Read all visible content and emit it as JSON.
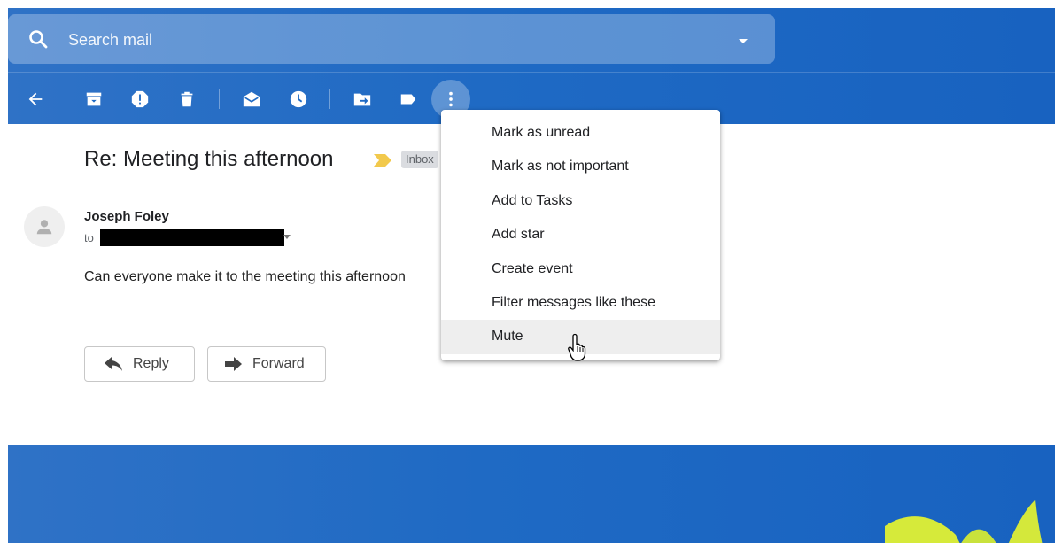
{
  "search": {
    "placeholder": "Search mail"
  },
  "toolbar": {
    "icons": [
      "back-arrow-icon",
      "archive-icon",
      "report-spam-icon",
      "delete-icon",
      "mark-read-icon",
      "snooze-icon",
      "move-to-icon",
      "label-icon",
      "more-vertical-icon"
    ]
  },
  "email": {
    "subject": "Re: Meeting this afternoon",
    "label": "Inbox",
    "sender": "Joseph Foley",
    "to": "to",
    "body": "Can everyone make it to the meeting this afternoon",
    "reply_label": "Reply",
    "forward_label": "Forward"
  },
  "menu": {
    "items": [
      "Mark as unread",
      "Mark as not important",
      "Add to Tasks",
      "Add star",
      "Create event",
      "Filter messages like these",
      "Mute"
    ],
    "hovered": "Mute"
  },
  "colors": {
    "accent": "#1a66c2",
    "important_marker": "#f2c94c",
    "menu_hover": "#eeeeee"
  }
}
